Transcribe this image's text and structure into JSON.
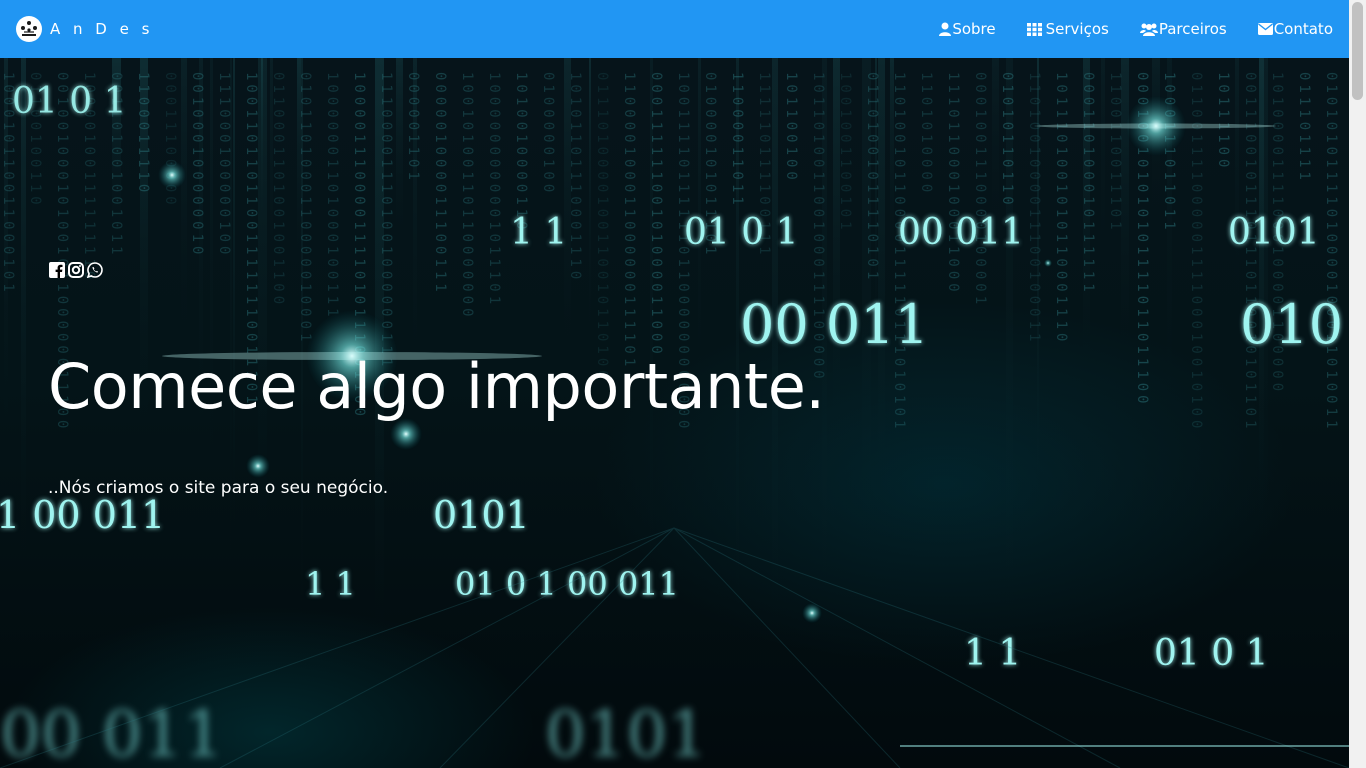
{
  "navbar": {
    "brand": "A n D e s",
    "links": [
      {
        "label": "Sobre",
        "icon": "user-icon"
      },
      {
        "label": "Serviços",
        "icon": "grid-icon"
      },
      {
        "label": "Parceiros",
        "icon": "users-icon"
      },
      {
        "label": "Contato",
        "icon": "envelope-icon"
      }
    ]
  },
  "hero": {
    "social_icons": [
      "facebook-icon",
      "instagram-icon",
      "whatsapp-icon"
    ],
    "headline": "Comece algo importante.",
    "subline": "..Nós criamos o site para o seu negócio."
  },
  "colors": {
    "navbar_bg": "#2196f3",
    "glow": "#7ef7f2"
  }
}
